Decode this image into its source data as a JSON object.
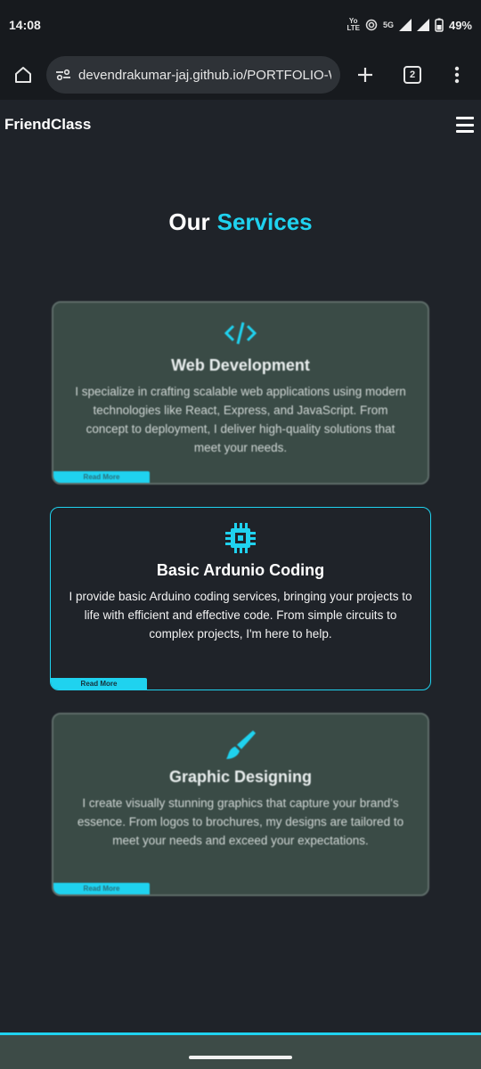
{
  "status": {
    "time": "14:08",
    "network_top": "Yo",
    "network_bottom": "LTE",
    "fiveg": "5G",
    "battery": "49%"
  },
  "browser": {
    "url": "devendrakumar-jaj.github.io/PORTFOLIO-WE",
    "tab_count": "2"
  },
  "site": {
    "brand": "FriendClass"
  },
  "services": {
    "title_part1": "Our",
    "title_part2": "Services",
    "accent_color": "#1fd2ef",
    "cards": [
      {
        "icon": "code-icon",
        "title": "Web Development",
        "text": "I specialize in crafting scalable web applications using modern technologies like React, Express, and JavaScript. From concept to deployment, I deliver high-quality solutions that meet your needs.",
        "read_more": "Read More"
      },
      {
        "icon": "chip-icon",
        "title": "Basic Ardunio Coding",
        "text": "I provide basic Arduino coding services, bringing your projects to life with efficient and effective code. From simple circuits to complex projects, I'm here to help.",
        "read_more": "Read More"
      },
      {
        "icon": "brush-icon",
        "title": "Graphic Designing",
        "text": "I create visually stunning graphics that capture your brand's essence. From logos to brochures, my designs are tailored to meet your needs and exceed your expectations.",
        "read_more": "Read More"
      }
    ]
  }
}
